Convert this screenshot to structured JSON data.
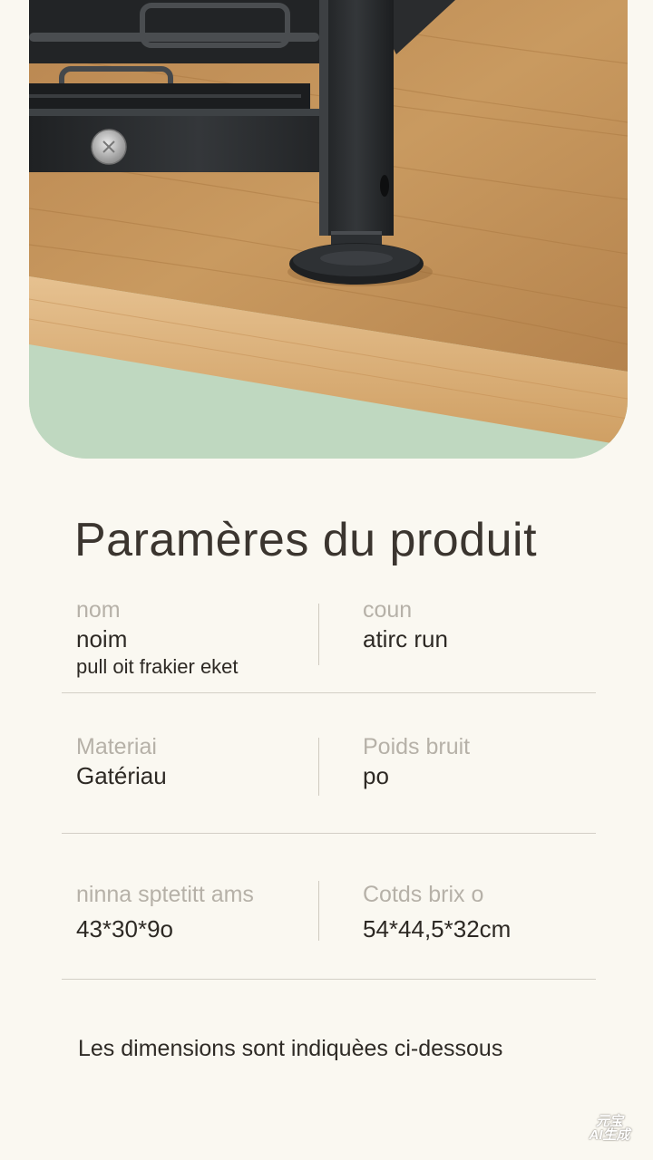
{
  "hero": {
    "image": "product-foot-on-wood-shelf"
  },
  "section_title": "Paramères du produit",
  "params": [
    {
      "label": "nom",
      "value": "noim",
      "extra": "pull oit frakier eket"
    },
    {
      "label": "coun",
      "value": "atirc run",
      "extra": ""
    },
    {
      "label": "Materiai",
      "value": "Gatériau",
      "extra": ""
    },
    {
      "label": "Poids bruit",
      "value": "po",
      "extra": ""
    },
    {
      "label": "ninna sptetitt ams",
      "value": "43*30*9o",
      "extra": ""
    },
    {
      "label": "Cotds brix o",
      "value": "54*44,5*32cm",
      "extra": ""
    }
  ],
  "note": "Les dimensions sont indiquèes ci-dessous",
  "watermark": {
    "line1": "元宝",
    "line2": "AI生成"
  },
  "colors": {
    "background": "#faf8f1",
    "wood": "#c99a5e",
    "mint": "#bfd8c0",
    "metal": "#26282a"
  }
}
